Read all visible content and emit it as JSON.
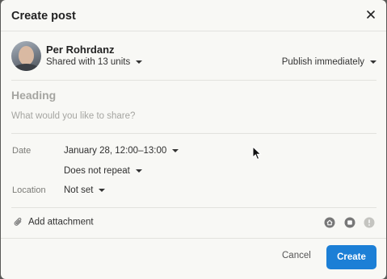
{
  "dialog": {
    "title": "Create post"
  },
  "author": {
    "name": "Per Rohrdanz",
    "shared": "Shared with 13 units"
  },
  "publish": "Publish immediately",
  "composer": {
    "heading_placeholder": "Heading",
    "body_placeholder": "What would you like to share?"
  },
  "fields": {
    "date_label": "Date",
    "date_value": "January 28, 12:00–13:00",
    "repeat_value": "Does not repeat",
    "location_label": "Location",
    "location_value": "Not set"
  },
  "toolbar": {
    "attachment_label": "Add attachment"
  },
  "footer": {
    "cancel_label": "Cancel",
    "create_label": "Create"
  },
  "colors": {
    "primary": "#1c7fd6",
    "background": "#f8f8f5",
    "placeholder": "#a5a5a1"
  },
  "icons": [
    "close-icon",
    "caret-down-icon",
    "paperclip-icon",
    "home-icon",
    "square-icon",
    "info-icon",
    "mouse-cursor-icon"
  ]
}
